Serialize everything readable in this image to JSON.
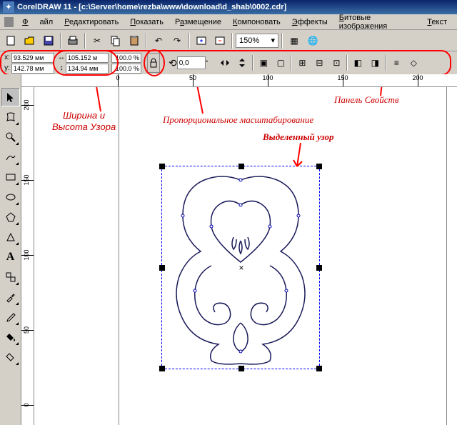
{
  "title": "CorelDRAW 11 - [c:\\Server\\home\\rezba\\www\\download\\d_shab\\0002.cdr]",
  "menus": [
    "Файл",
    "Редактировать",
    "Показать",
    "Размещение",
    "Компоновать",
    "Эффекты",
    "Битовые изображения",
    "Текст"
  ],
  "zoom": "150%",
  "position": {
    "x": "93.529 мм",
    "y": "142.78 мм"
  },
  "size": {
    "w": "105.152 м",
    "h": "134.94 мм"
  },
  "scale": {
    "x": "100.0 %",
    "y": "100.0 %"
  },
  "rotation": "0,0",
  "ruler_h": [
    "0",
    "50",
    "100",
    "150",
    "200"
  ],
  "ruler_v": [
    "200",
    "150",
    "100",
    "50",
    "0"
  ],
  "annotations": {
    "properties_panel": "Панель Свойств",
    "width_height": "Ширина и Высота Узора",
    "proportional_scale": "Пропорциональное масштабирование",
    "selected_pattern": "Выделенный узор"
  }
}
